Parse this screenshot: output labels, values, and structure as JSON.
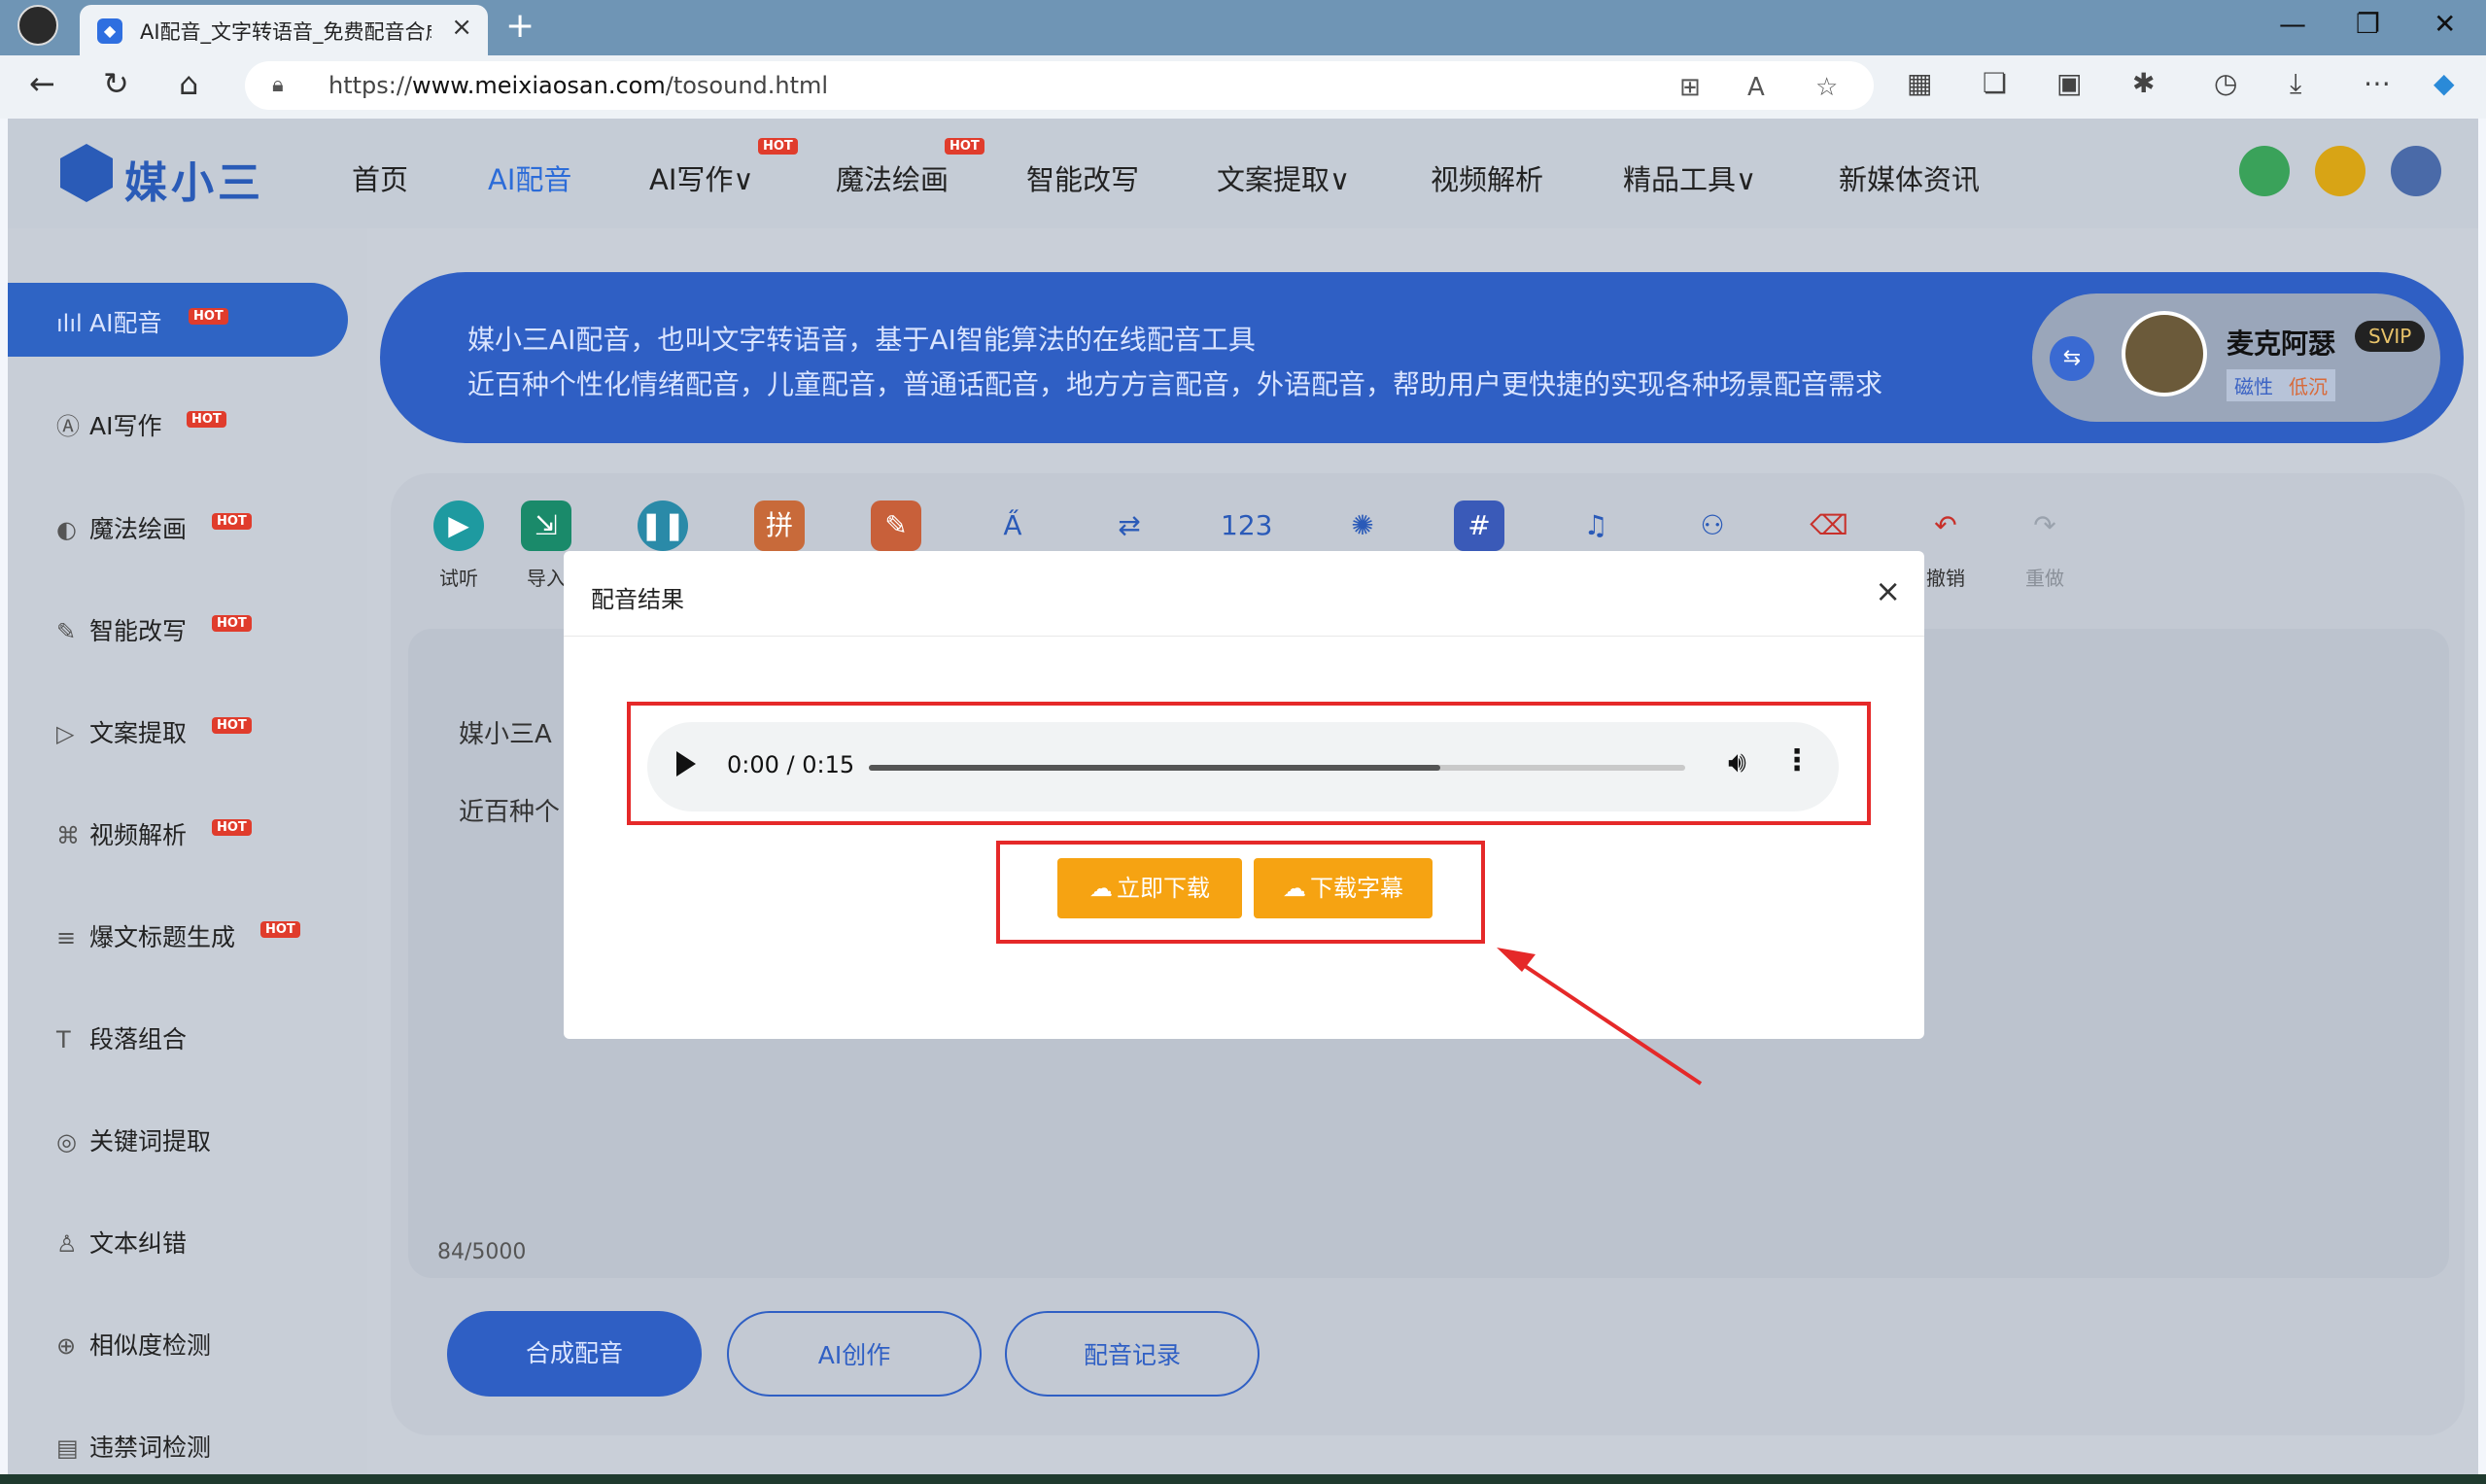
{
  "browser": {
    "tab_title": "AI配音_文字转语音_免费配音合成",
    "url_prefix": "https://",
    "url_domain": "www.meixiaosan.com",
    "url_path": "/tosound.html"
  },
  "site": {
    "logo": "媒小三",
    "nav": [
      "首页",
      "AI配音",
      "AI写作∨",
      "魔法绘画",
      "智能改写",
      "文案提取∨",
      "视频解析",
      "精品工具∨",
      "新媒体资讯"
    ],
    "hot": "HOT",
    "sidebar": [
      "AI配音",
      "AI写作",
      "魔法绘画",
      "智能改写",
      "文案提取",
      "视频解析",
      "爆文标题生成",
      "段落组合",
      "关键词提取",
      "文本纠错",
      "相似度检测",
      "违禁词检测"
    ],
    "banner": {
      "line1": "媒小三AI配音，也叫文字转语音，基于AI智能算法的在线配音工具",
      "line2": "近百种个性化情绪配音，儿童配音，普通话配音，地方方言配音，外语配音，帮助用户更快捷的实现各种场景配音需求"
    },
    "voice": {
      "name": "麦克阿瑟",
      "badge": "SVIP",
      "tag1": "磁性",
      "tag2": "低沉"
    },
    "tools": {
      "listen": "试听",
      "import": "导入",
      "undo": "撤销",
      "redo": "重做"
    },
    "editor": {
      "line1": "媒小三A",
      "line2": "近百种个",
      "count": "84/5000"
    },
    "actions": {
      "synth": "合成配音",
      "ai": "AI创作",
      "records": "配音记录"
    }
  },
  "modal": {
    "title": "配音结果",
    "close": "×",
    "audio_time": "0:00 / 0:15",
    "audio_progress": 0.7,
    "download_btn": "立即下载",
    "subtitle_btn": "下载字幕"
  }
}
